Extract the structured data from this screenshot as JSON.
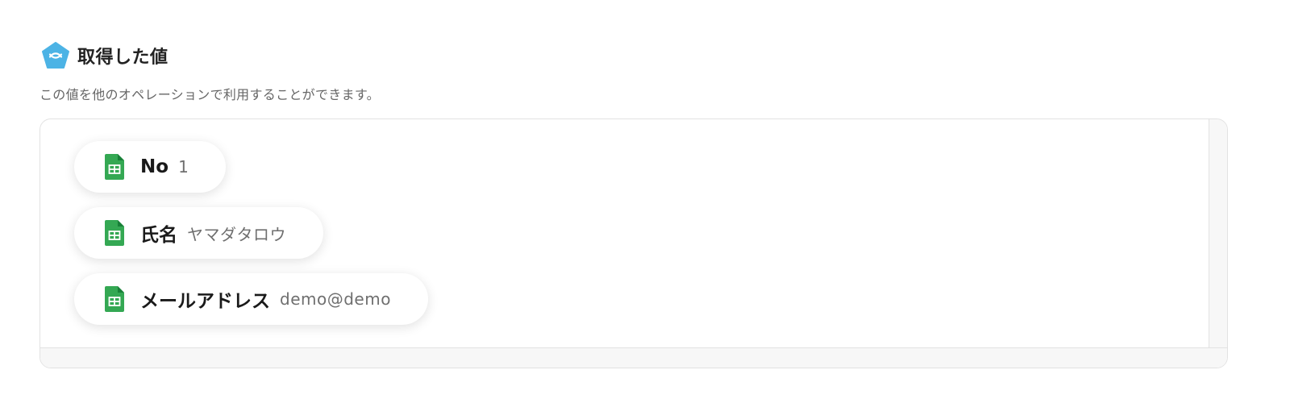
{
  "section": {
    "title": "取得した値",
    "description": "この値を他のオペレーションで利用することができます。",
    "icon": "pentagon-x-icon",
    "icon_color": "#4cb3e5"
  },
  "outputs": [
    {
      "icon": "google-sheets-icon",
      "label": "No",
      "value": "1"
    },
    {
      "icon": "google-sheets-icon",
      "label": "氏名",
      "value": "ヤマダタロウ"
    },
    {
      "icon": "google-sheets-icon",
      "label": "メールアドレス",
      "value": "demo@demo"
    }
  ],
  "colors": {
    "sheets_green": "#34a853",
    "sheets_dark_green": "#188038",
    "text_primary": "#1a1a1a",
    "text_secondary": "#6f6f6f"
  }
}
